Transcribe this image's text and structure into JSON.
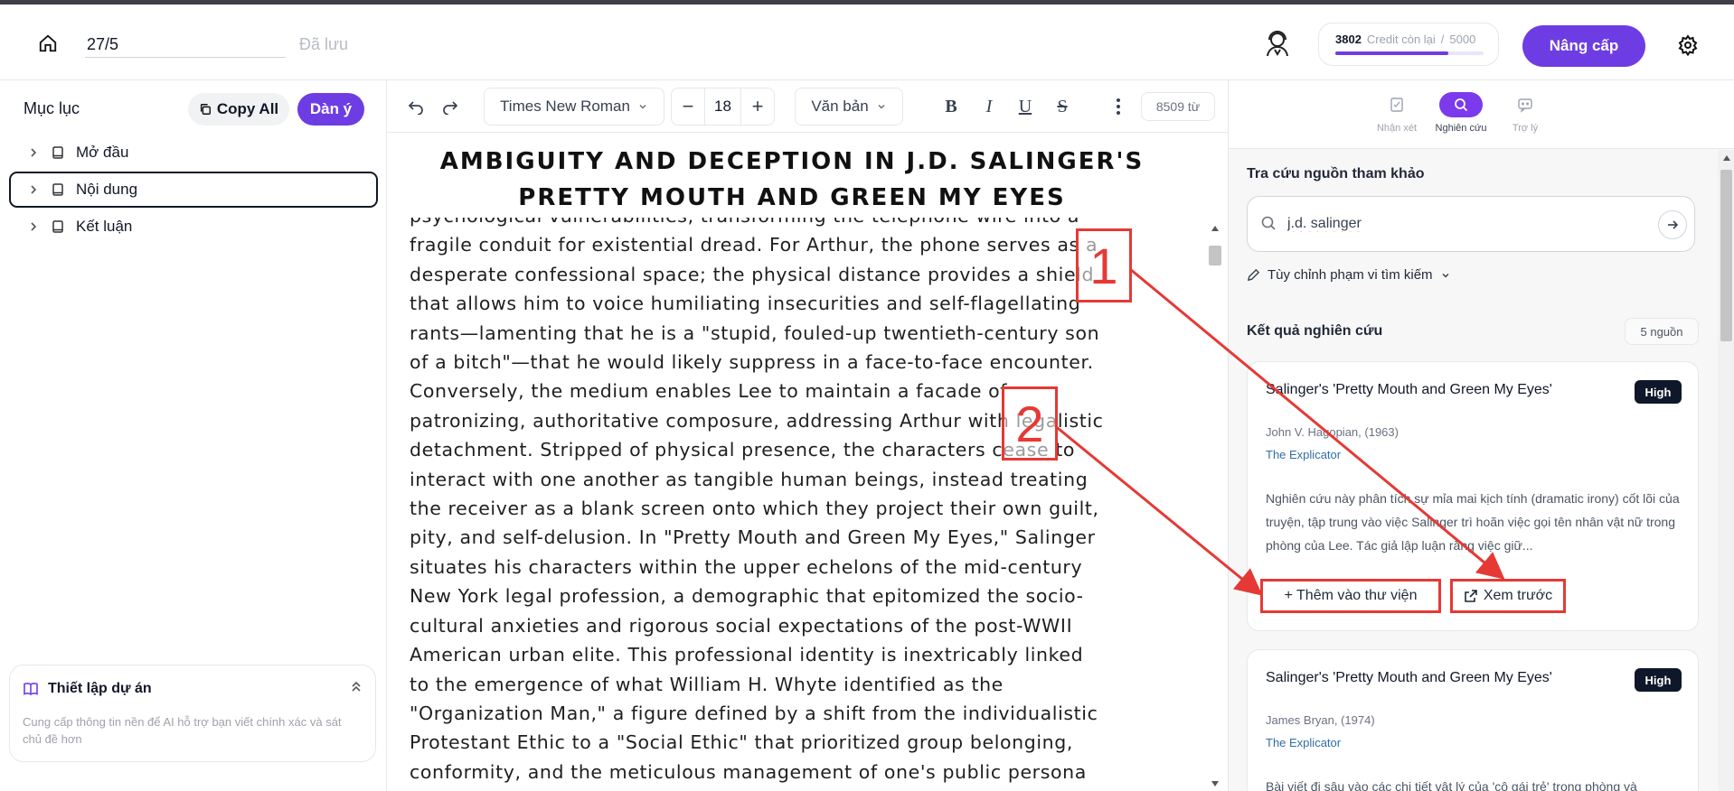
{
  "header": {
    "document_title": "27/5",
    "save_status": "Đã lưu",
    "credits": {
      "remaining": "3802",
      "label": "Credit còn lại",
      "separator": "/",
      "total": "5000",
      "fraction_remaining": 0.76
    },
    "upgrade_label": "Nâng cấp"
  },
  "sidebar": {
    "title": "Mục lục",
    "copy_all_label": "Copy All",
    "outline_label": "Dàn ý",
    "items": [
      {
        "label": "Mở đầu",
        "active": false
      },
      {
        "label": "Nội dung",
        "active": true
      },
      {
        "label": "Kết luận",
        "active": false
      }
    ],
    "project": {
      "title": "Thiết lập dự án",
      "description": "Cung cấp thông tin nền để AI hỗ trợ bạn viết chính xác và sát chủ đề hơn"
    }
  },
  "toolbar": {
    "font_family": "Times New Roman",
    "font_size": "18",
    "text_style": "Văn bản",
    "word_count": "8509 từ"
  },
  "document": {
    "heading_line1": "AMBIGUITY AND DECEPTION IN J.D. SALINGER'S",
    "heading_line2": "PRETTY MOUTH AND GREEN MY EYES",
    "lines": [
      "psychological vulnerabilities, transforming the telephone wire into a",
      "fragile conduit for existential dread. For Arthur, the phone serves as a",
      "desperate confessional space; the physical distance provides a shield",
      "that allows him to voice humiliating insecurities and self-flagellating",
      "rants—lamenting that he is a \"stupid, fouled-up twentieth-century son",
      "of a bitch\"—that he would likely suppress in a face-to-face encounter.",
      "Conversely, the medium enables Lee to maintain a facade of",
      "patronizing, authoritative composure, addressing Arthur with legalistic",
      "detachment. Stripped of physical presence, the characters cease to",
      "interact with one another as tangible human beings, instead treating",
      "the receiver as a blank screen onto which they project their own guilt,",
      "pity, and self-delusion. In \"Pretty Mouth and Green My Eyes,\" Salinger",
      "situates his characters within the upper echelons of the mid-century",
      "New York legal profession, a demographic that epitomized the socio-",
      "cultural anxieties and rigorous social expectations of the post-WWII",
      "American urban elite. This professional identity is inextricably linked",
      "to the emergence of what William H. Whyte identified as the",
      "\"Organization Man,\" a figure defined by a shift from the individualistic",
      "Protestant Ethic to a \"Social Ethic\" that prioritized group belonging,",
      "conformity, and the meticulous management of one's public persona"
    ]
  },
  "right_panel": {
    "tabs": [
      {
        "label": "Nhận xét",
        "icon": "review-icon",
        "active": false
      },
      {
        "label": "Nghiên cứu",
        "icon": "search-icon",
        "active": true
      },
      {
        "label": "Trợ lý",
        "icon": "chat-icon",
        "active": false
      }
    ],
    "search_title": "Tra cứu nguồn tham khảo",
    "search_value": "j.d. salinger",
    "scope_label": "Tùy chỉnh phạm vi tìm kiếm",
    "results_title": "Kết quả nghiên cứu",
    "results_count": "5 nguồn",
    "results": [
      {
        "title": "Salinger's 'Pretty Mouth and Green My Eyes'",
        "badge": "High",
        "author": "John V. Hagopian, (1963)",
        "journal": "The Explicator",
        "abstract": "Nghiên cứu này phân tích sự mỉa mai kịch tính (dramatic irony) cốt lõi của truyện, tập trung vào việc Salinger trì hoãn việc gọi tên nhân vật nữ trong phòng của Lee. Tác giả lập luận rằng việc giữ...",
        "add_label": "+ Thêm vào thư viện",
        "preview_label": "Xem trước"
      },
      {
        "title": "Salinger's 'Pretty Mouth and Green My Eyes'",
        "badge": "High",
        "author": "James Bryan, (1974)",
        "journal": "The Explicator",
        "abstract": "Bài viết đi sâu vào các chi tiết vật lý của 'cô gái trẻ' trong phòng và"
      }
    ]
  },
  "annotations": [
    {
      "label": "1",
      "color": "#e53935"
    },
    {
      "label": "2",
      "color": "#e53935"
    }
  ]
}
